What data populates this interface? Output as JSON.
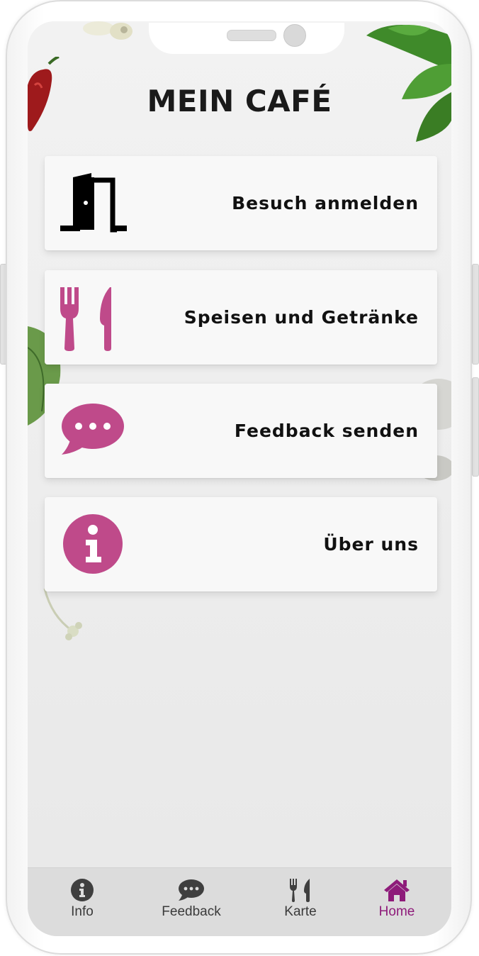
{
  "app": {
    "title": "MEIN CAFÉ"
  },
  "menu": {
    "items": [
      {
        "label": "Besuch anmelden",
        "icon": "door-icon"
      },
      {
        "label": "Speisen und Getränke",
        "icon": "utensils-icon"
      },
      {
        "label": "Feedback senden",
        "icon": "comment-dots-icon"
      },
      {
        "label": "Über uns",
        "icon": "info-icon"
      }
    ]
  },
  "nav": {
    "items": [
      {
        "label": "Info",
        "icon": "info-icon",
        "active": false
      },
      {
        "label": "Feedback",
        "icon": "comment-dots-icon",
        "active": false
      },
      {
        "label": "Karte",
        "icon": "utensils-icon",
        "active": false
      },
      {
        "label": "Home",
        "icon": "home-icon",
        "active": true
      }
    ]
  },
  "colors": {
    "accent": "#bf4a8a",
    "nav_active": "#8e1b7a",
    "title": "#1a1a1a",
    "card_bg": "#f8f8f8"
  }
}
